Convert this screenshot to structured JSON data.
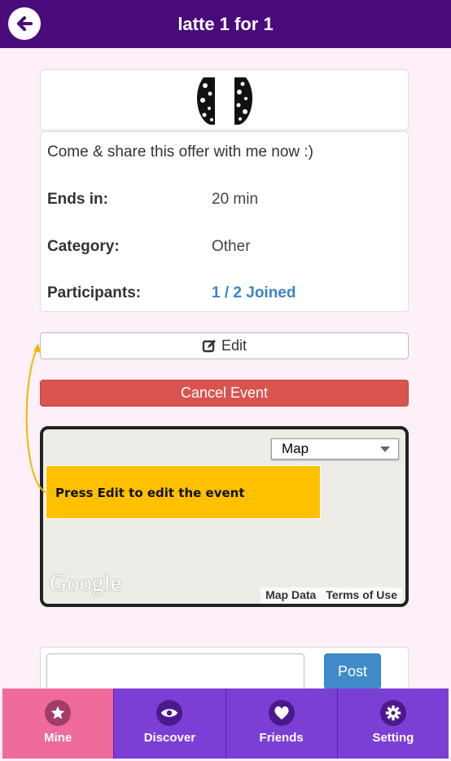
{
  "header": {
    "title": "latte 1 for 1"
  },
  "event": {
    "description": "Come & share this offer with me now :)",
    "rows": [
      {
        "label": "Ends in:",
        "value": "20 min"
      },
      {
        "label": "Category:",
        "value": "Other"
      },
      {
        "label": "Participants:",
        "value": "1 / 2 Joined"
      }
    ]
  },
  "actions": {
    "edit_label": "Edit",
    "cancel_label": "Cancel Event"
  },
  "map": {
    "type_selected": "Map",
    "logo_text": "Google",
    "map_data_label": "Map Data",
    "terms_label": "Terms of Use"
  },
  "tooltip": {
    "text": "Press Edit to edit the event"
  },
  "comment": {
    "post_label": "Post"
  },
  "tabs": [
    {
      "label": "Mine",
      "icon": "star-icon",
      "active": true
    },
    {
      "label": "Discover",
      "icon": "eye-icon",
      "active": false
    },
    {
      "label": "Friends",
      "icon": "heart-icon",
      "active": false
    },
    {
      "label": "Setting",
      "icon": "gear-icon",
      "active": false
    }
  ],
  "colors": {
    "header_bg": "#4a0b7a",
    "tab_bg": "#7b3fd6",
    "tab_active_bg": "#ef6b9c",
    "cancel_bg": "#d9534f",
    "link_blue": "#3b85c9",
    "tooltip_bg": "#ffc000"
  }
}
